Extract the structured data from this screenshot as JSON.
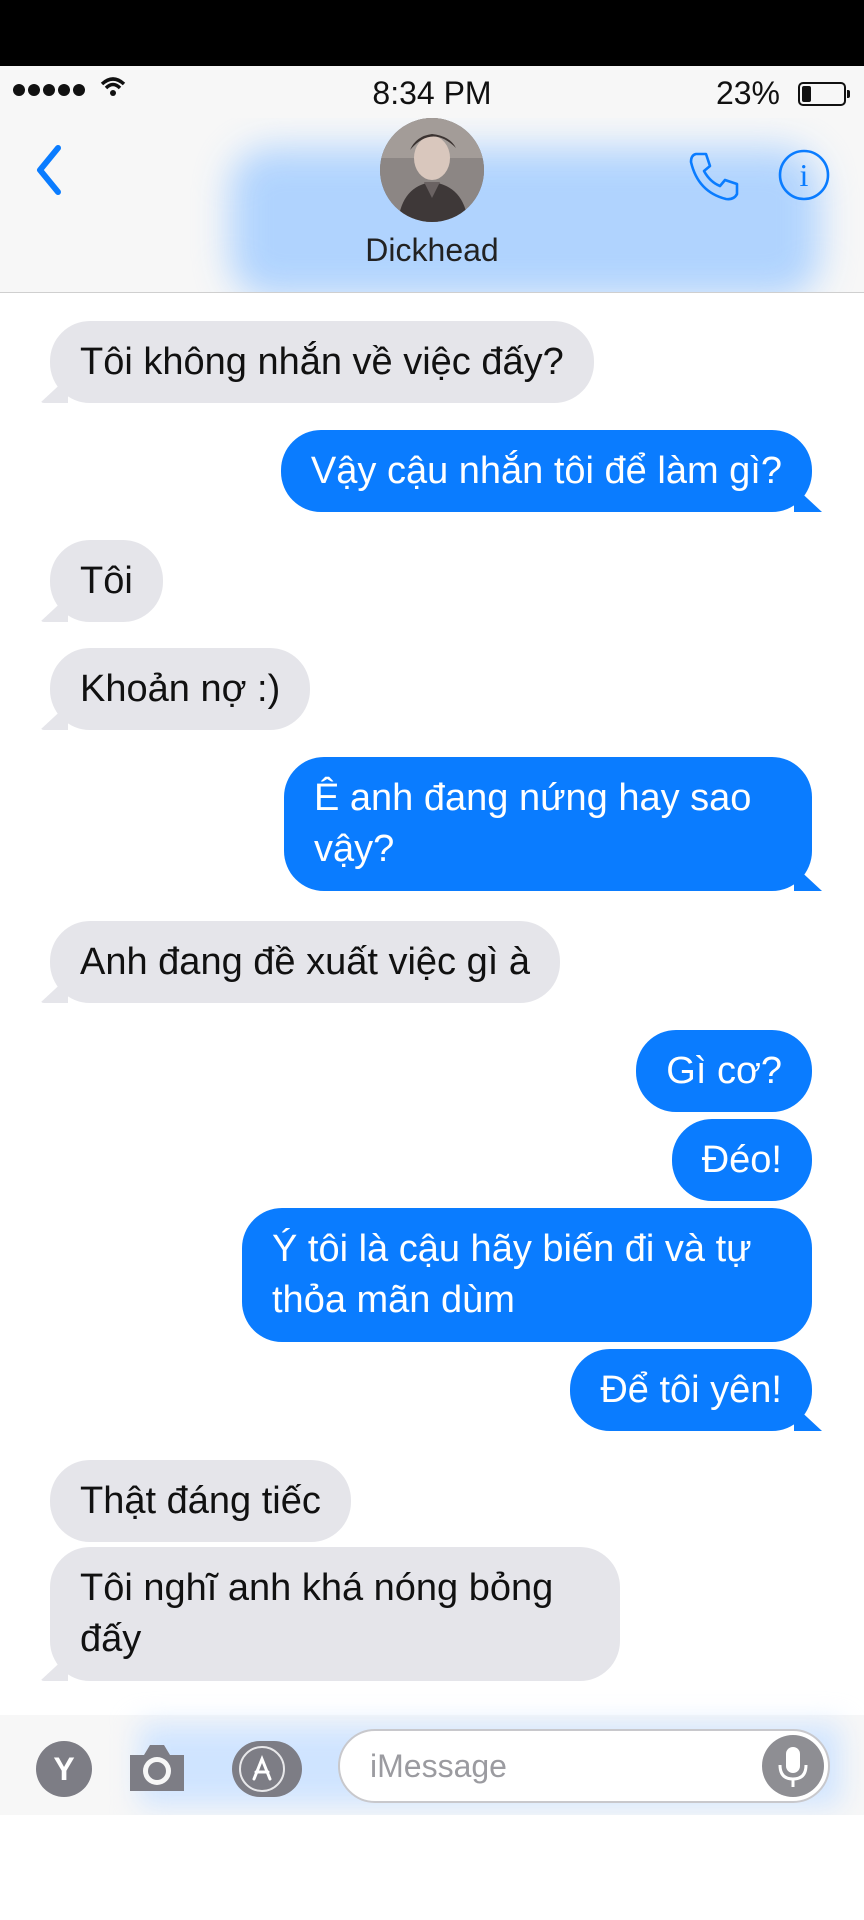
{
  "status_bar": {
    "time": "8:34 PM",
    "battery": "23%",
    "battery_level": 0.23
  },
  "header": {
    "contact_name": "Dickhead",
    "back_icon": "chevron-left-icon",
    "call_icon": "phone-icon",
    "info_icon": "info-icon"
  },
  "messages": [
    {
      "from": "them",
      "text": "Tôi không nhắn về việc đấy?"
    },
    {
      "from": "me",
      "text": "Vậy cậu nhắn tôi để làm gì?"
    },
    {
      "from": "them",
      "text": "Tôi"
    },
    {
      "from": "them",
      "text": "Khoản nợ :)"
    },
    {
      "from": "me",
      "lines": [
        "Ê anh đang nứng hay sao",
        "vậy?"
      ]
    },
    {
      "from": "them",
      "text": "Anh đang đề xuất việc gì à"
    },
    {
      "from": "me",
      "text": "Gì cơ?"
    },
    {
      "from": "me",
      "text": "Đéo!"
    },
    {
      "from": "me",
      "lines": [
        "Ý tôi là cậu hãy biến đi và tự",
        "thỏa mãn dùm"
      ]
    },
    {
      "from": "me",
      "text": "Để tôi yên!"
    },
    {
      "from": "them",
      "text": "Thật đáng tiếc"
    },
    {
      "from": "them",
      "lines": [
        "Tôi nghĩ anh khá nóng bỏng",
        "đấy"
      ]
    }
  ],
  "input_bar": {
    "y_button": "Y",
    "placeholder": "iMessage"
  },
  "colors": {
    "sent_bubble": "#0a7cff",
    "received_bubble": "#e5e5ea",
    "accent": "#0a7cff"
  }
}
